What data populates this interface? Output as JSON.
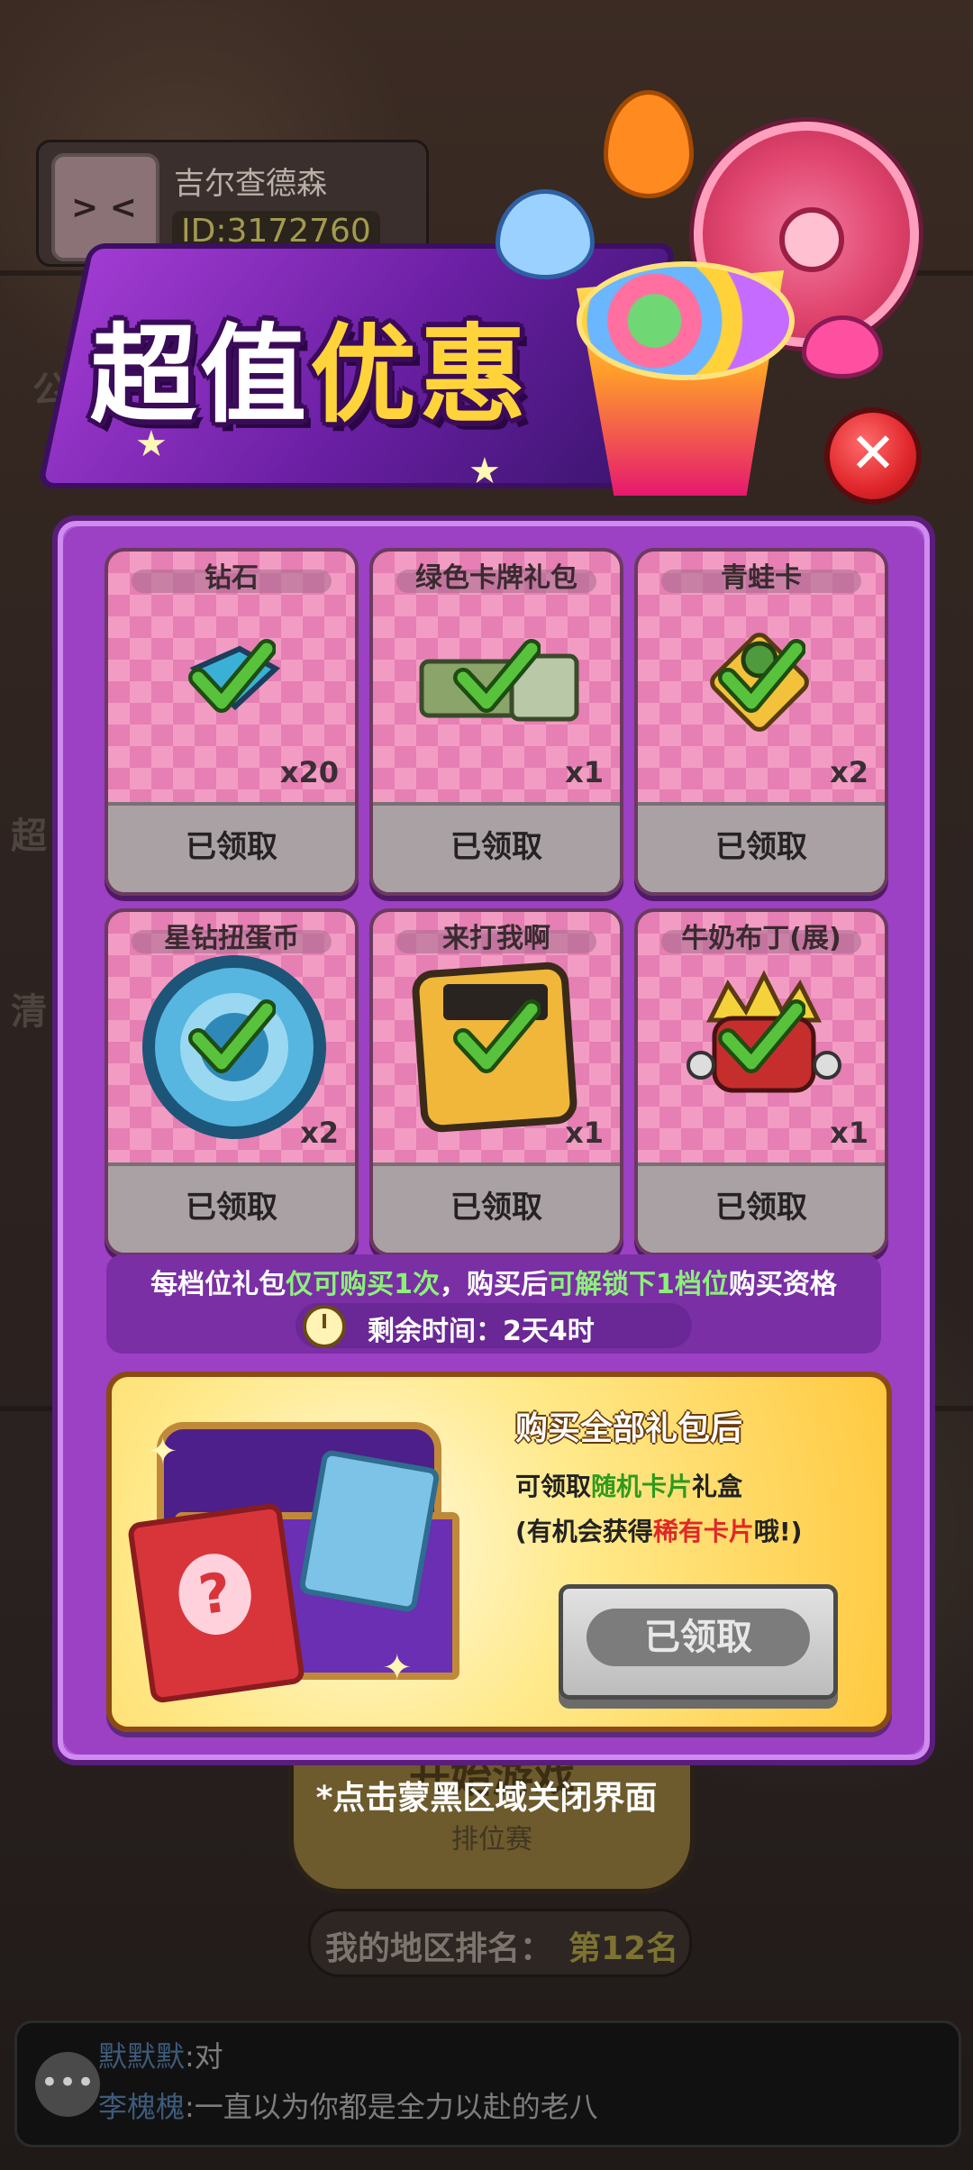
{
  "background": {
    "player_name": "吉尔查德森",
    "player_id": "ID:3172760",
    "side_labels": [
      "公告",
      "超",
      "清"
    ],
    "start_button": {
      "title": "开始游戏",
      "subtitle": "排位赛"
    },
    "rank": {
      "label": "我的地区排名：",
      "value": "第12名"
    },
    "chat": [
      {
        "who": "默默默",
        "text": ":对"
      },
      {
        "who": "李槐槐",
        "text": ":一直以为你都是全力以赴的老八"
      }
    ]
  },
  "banner": {
    "title_white": "超值",
    "title_yellow": "优惠"
  },
  "items": [
    {
      "name": "钻石",
      "qty": "x20",
      "status": "已领取",
      "icon": "diamond-icon"
    },
    {
      "name": "绿色卡牌礼包",
      "qty": "x1",
      "status": "已领取",
      "icon": "card-pack-icon"
    },
    {
      "name": "青蛙卡",
      "qty": "x2",
      "status": "已领取",
      "icon": "frog-card-icon"
    },
    {
      "name": "星钻扭蛋币",
      "qty": "x2",
      "status": "已领取",
      "icon": "gacha-coin-icon"
    },
    {
      "name": "来打我啊",
      "qty": "x1",
      "status": "已领取",
      "icon": "sticker-icon"
    },
    {
      "name": "牛奶布丁(展)",
      "qty": "x1",
      "status": "已领取",
      "icon": "pudding-character-icon"
    }
  ],
  "rule": {
    "p1": "每档位礼包",
    "p2": "仅可购买1次",
    "p3": "，购买后",
    "p4": "可解锁下1档位",
    "p5": "购买资格"
  },
  "timer": {
    "label": "剩余时间：2天4时"
  },
  "bonus": {
    "title": "购买全部礼包后",
    "line1_a": "可领取",
    "line1_b": "随机卡片",
    "line1_c": "礼盒",
    "line2_a": "(有机会获得",
    "line2_b": "稀有卡片",
    "line2_c": "哦!)",
    "button": "已领取"
  },
  "close_hint": "*点击蒙黑区域关闭界面",
  "colors": {
    "highlight_green": "#8cf07a",
    "rare_red": "#e02828",
    "panel_purple": "#9c40c4"
  }
}
